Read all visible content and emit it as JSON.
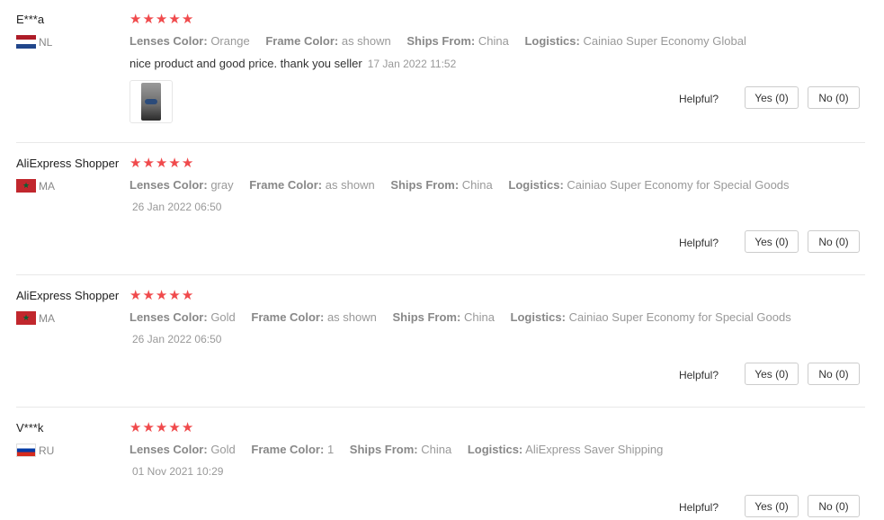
{
  "helpful_label": "Helpful?",
  "star_color": "#f04a4c",
  "reviews": [
    {
      "user": "E***a",
      "country": "NL",
      "flag": "flag-nl-icon",
      "rating": 5,
      "attributes": [
        {
          "label": "Lenses Color:",
          "value": "Orange"
        },
        {
          "label": "Frame Color:",
          "value": "as shown"
        },
        {
          "label": "Ships From:",
          "value": "China"
        },
        {
          "label": "Logistics:",
          "value": "Cainiao Super Economy Global"
        }
      ],
      "text": "nice product and good price. thank you seller",
      "date": "17 Jan 2022 11:52",
      "yes": "Yes (0)",
      "no": "No (0)"
    },
    {
      "user": "AliExpress Shopper",
      "country": "MA",
      "flag": "flag-ma-icon",
      "rating": 5,
      "attributes": [
        {
          "label": "Lenses Color:",
          "value": "gray"
        },
        {
          "label": "Frame Color:",
          "value": "as shown"
        },
        {
          "label": "Ships From:",
          "value": "China"
        },
        {
          "label": "Logistics:",
          "value": "Cainiao Super Economy for Special Goods"
        }
      ],
      "date": "26 Jan 2022 06:50",
      "yes": "Yes (0)",
      "no": "No (0)"
    },
    {
      "user": "AliExpress Shopper",
      "country": "MA",
      "flag": "flag-ma-icon",
      "rating": 5,
      "attributes": [
        {
          "label": "Lenses Color:",
          "value": "Gold"
        },
        {
          "label": "Frame Color:",
          "value": "as shown"
        },
        {
          "label": "Ships From:",
          "value": "China"
        },
        {
          "label": "Logistics:",
          "value": "Cainiao Super Economy for Special Goods"
        }
      ],
      "date": "26 Jan 2022 06:50",
      "yes": "Yes (0)",
      "no": "No (0)"
    },
    {
      "user": "V***k",
      "country": "RU",
      "flag": "flag-ru-icon",
      "rating": 5,
      "attributes": [
        {
          "label": "Lenses Color:",
          "value": "Gold"
        },
        {
          "label": "Frame Color:",
          "value": "1"
        },
        {
          "label": "Ships From:",
          "value": "China"
        },
        {
          "label": "Logistics:",
          "value": "AliExpress Saver Shipping"
        }
      ],
      "date": "01 Nov 2021 10:29",
      "yes": "Yes (0)",
      "no": "No (0)"
    }
  ]
}
